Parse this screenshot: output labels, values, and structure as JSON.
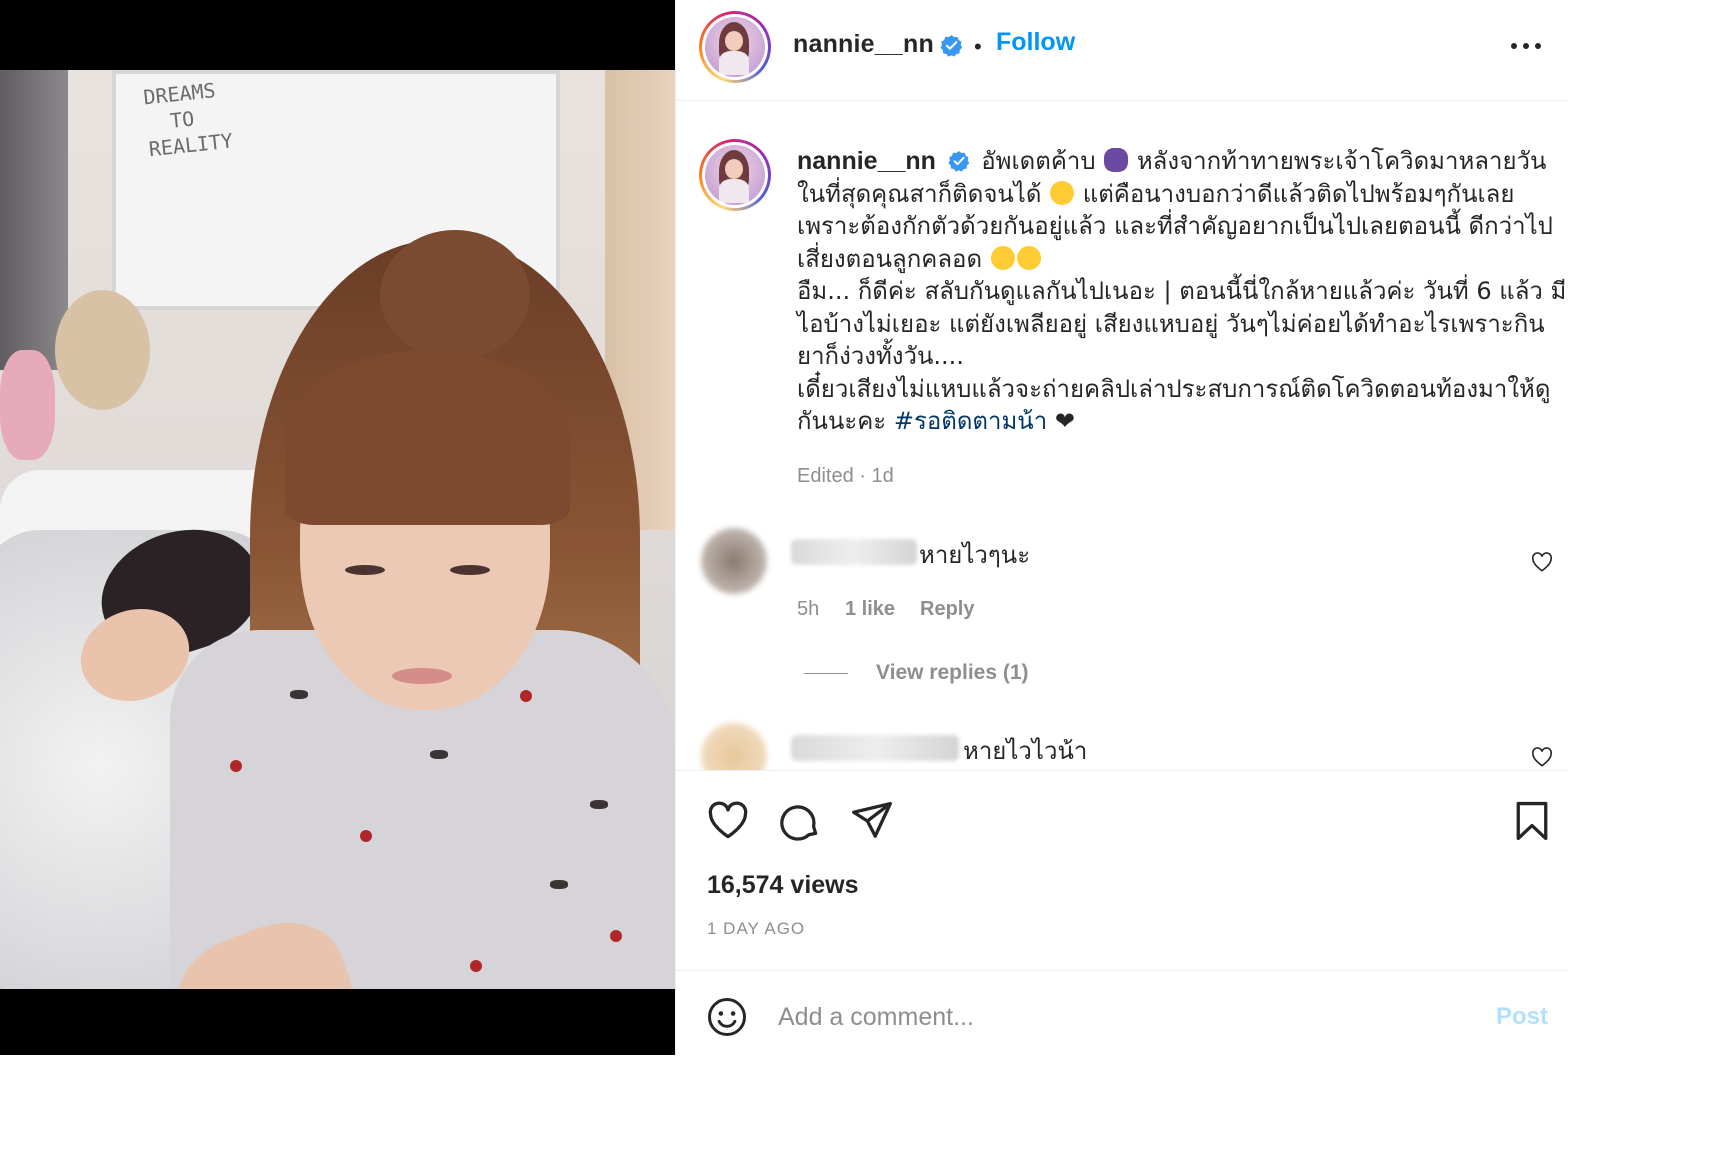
{
  "post": {
    "username": "nannie__nn",
    "follow_label": "Follow",
    "separator": "•",
    "caption_lines": [
      "อัพเดตค้าบ",
      "หลังจากท้าทายพระเจ้าโควิดมาหลายวัน",
      "ในที่สุดคุณสาก็ติดจนได้",
      "แต่คือนางบอกว่าดีแล้วติดไปพร้อมๆกันเลย",
      "เพราะต้องกักตัวด้วยกันอยู่แล้ว และที่สำคัญอยากเป็นไปเลยตอนนี้ ดีกว่าไป",
      "เสี่ยงตอนลูกคลอด",
      "อืม... ก็ดีค่ะ สลับกันดูแลกันไปเนอะ | ตอนนี้นี่ใกล้หายแล้วค่ะ วันที่ 6 แล้ว มี",
      "ไอบ้างไม่เยอะ แต่ยังเพลียอยู่ เสียงแหบอยู่ วันๆไม่ค่อยได้ทำอะไรเพราะกิน",
      "ยาก็ง่วงทั้งวัน....",
      "เดี๋ยวเสียงไม่แหบแล้วจะถ่ายคลิปเล่าประสบการณ์ติดโควิดตอนท้องมาให้ดู",
      "กันนะคะ"
    ],
    "hashtag": "#รอติดตามน้า",
    "heart_glyph": "❤",
    "edited": "Edited · 1d",
    "views": "16,574 views",
    "time_ago": "1 DAY AGO"
  },
  "comments": [
    {
      "text": "หายไวๆนะ",
      "time": "5h",
      "likes": "1 like",
      "reply_label": "Reply",
      "view_replies": "View replies (1)"
    },
    {
      "text": "หายไวไวน้า"
    }
  ],
  "video": {
    "whiteboard_text": "DREAMS\n  TO\nREALITY"
  },
  "composer": {
    "placeholder": "Add a comment...",
    "post_label": "Post"
  },
  "colors": {
    "accent": "#0095f6",
    "hashtag": "#00376b",
    "muted": "#8e8e8e",
    "post_disabled": "#b2dffc",
    "verified": "#3897f0"
  },
  "icons": [
    "verified-icon",
    "more-icon",
    "heart-icon",
    "comment-icon",
    "share-icon",
    "bookmark-icon",
    "smile-icon"
  ]
}
